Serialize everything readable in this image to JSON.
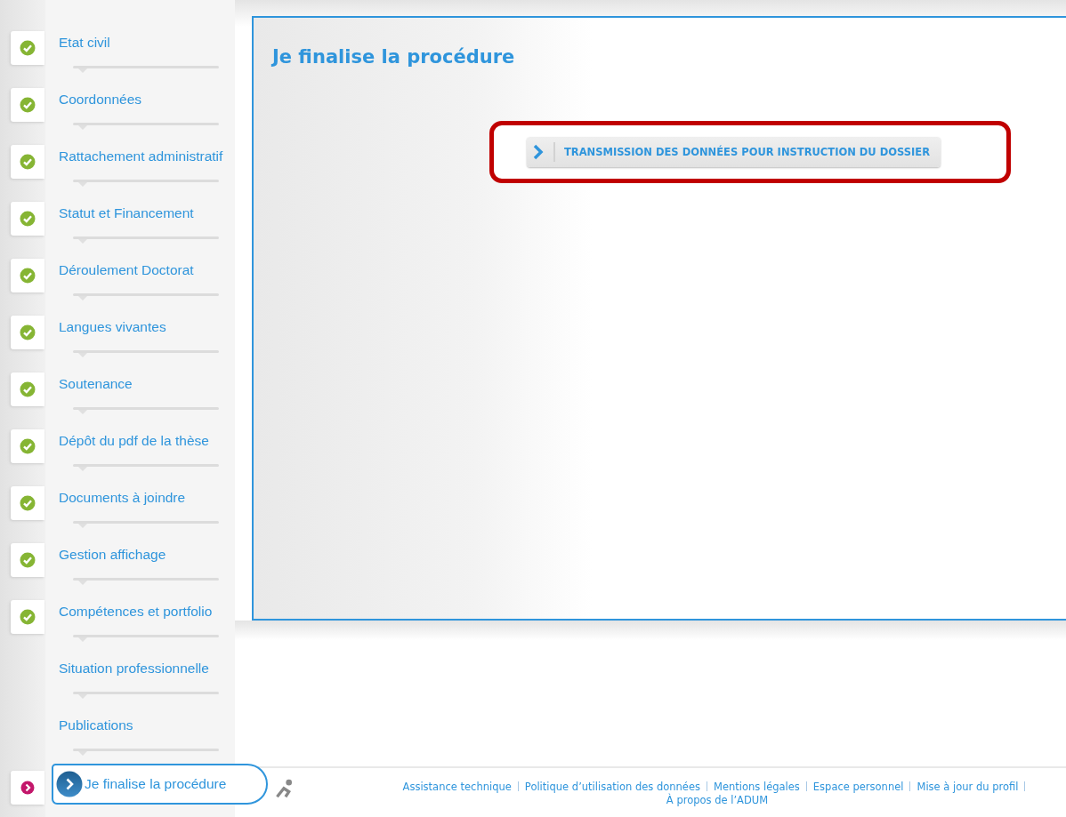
{
  "sidebar": {
    "items": [
      {
        "label": "Etat civil",
        "kind": "done",
        "selected": false
      },
      {
        "label": "Coordonnées",
        "kind": "done",
        "selected": false
      },
      {
        "label": "Rattachement administratif",
        "kind": "done",
        "selected": false
      },
      {
        "label": "Statut et Financement",
        "kind": "done",
        "selected": false
      },
      {
        "label": "Déroulement Doctorat",
        "kind": "done",
        "selected": false
      },
      {
        "label": "Langues vivantes",
        "kind": "done",
        "selected": false
      },
      {
        "label": "Soutenance",
        "kind": "done",
        "selected": false
      },
      {
        "label": "Dépôt du pdf de la thèse",
        "kind": "done",
        "selected": false
      },
      {
        "label": "Documents à joindre",
        "kind": "done",
        "selected": false
      },
      {
        "label": "Gestion affichage",
        "kind": "done",
        "selected": false
      },
      {
        "label": "Compétences et portfolio",
        "kind": "done",
        "selected": false
      },
      {
        "label": "Situation professionnelle",
        "kind": "pending",
        "selected": false
      },
      {
        "label": "Publications",
        "kind": "pending",
        "selected": false
      },
      {
        "label": "Je finalise la procédure",
        "kind": "current",
        "selected": true
      }
    ]
  },
  "panel": {
    "title": "Je finalise la procédure",
    "action": {
      "label": "TRANSMISSION DES DONNÉES POUR INSTRUCTION DU DOSSIER",
      "highlighted": true
    }
  },
  "footer": {
    "links": [
      "Assistance technique",
      "Politique d’utilisation des données",
      "Mentions légales",
      "Espace personnel",
      "Mise à jour du profil",
      "À propos de l’ADUM"
    ]
  }
}
